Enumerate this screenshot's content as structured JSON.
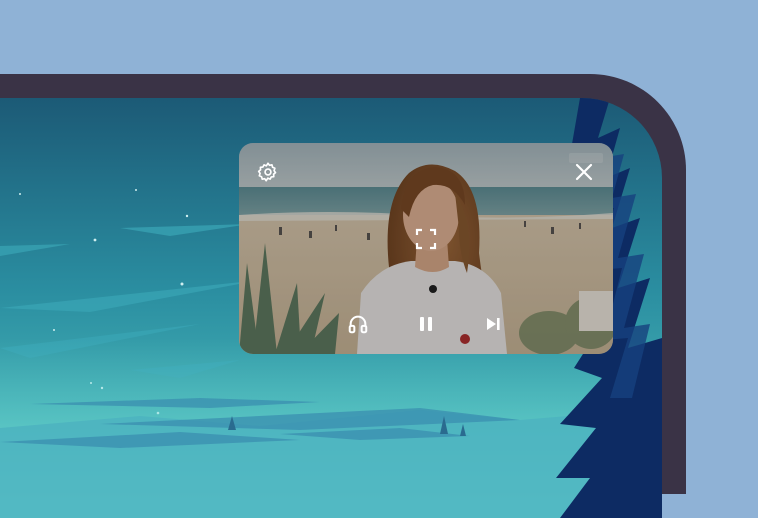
{
  "pip_player": {
    "controls": {
      "settings": "gear-icon",
      "close": "close-icon",
      "fullscreen": "fullscreen-icon",
      "audio_only": "headphones-icon",
      "play_pause": "pause-icon",
      "next": "skip-next-icon"
    },
    "state": "playing"
  },
  "colors": {
    "backdrop": "#8fb2d6",
    "device_frame": "#3a3346",
    "control_icon": "#ffffff"
  }
}
